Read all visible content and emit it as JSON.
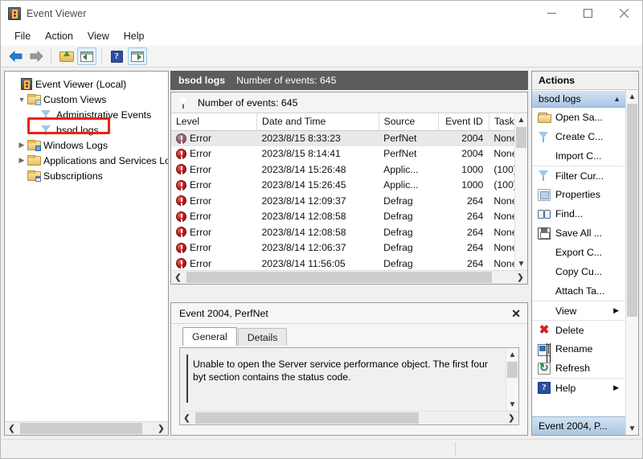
{
  "window": {
    "title": "Event Viewer",
    "icon": "event-viewer-icon",
    "controls": {
      "minimize": "minimize-icon",
      "maximize": "maximize-icon",
      "close": "close-icon"
    }
  },
  "menubar": {
    "items": [
      "File",
      "Action",
      "View",
      "Help"
    ]
  },
  "toolbar": {
    "buttons": [
      {
        "name": "back-icon",
        "label": "Back"
      },
      {
        "name": "forward-icon",
        "label": "Forward"
      },
      {
        "name": "up-folder-icon",
        "label": "Up One Level"
      },
      {
        "name": "show-hide-console-tree-icon",
        "label": "Show/Hide Console Tree"
      },
      {
        "name": "help-icon",
        "label": "Help"
      },
      {
        "name": "show-hide-action-pane-icon",
        "label": "Show/Hide Action Pane"
      }
    ]
  },
  "tree": {
    "nodes": [
      {
        "label": "Event Viewer (Local)",
        "icon": "event-viewer-icon",
        "indent": 0,
        "twist": "",
        "selected": false
      },
      {
        "label": "Custom Views",
        "icon": "folder-icon",
        "indent": 1,
        "twist": "expanded",
        "selected": false
      },
      {
        "label": "Administrative Events",
        "icon": "filter-icon",
        "indent": 2,
        "twist": "",
        "selected": false
      },
      {
        "label": "bsod logs",
        "icon": "filter-icon",
        "indent": 2,
        "twist": "",
        "selected": true
      },
      {
        "label": "Windows Logs",
        "icon": "folder-blue-icon",
        "indent": 1,
        "twist": "collapsed",
        "selected": false
      },
      {
        "label": "Applications and Services Lo",
        "icon": "folder-icon",
        "indent": 1,
        "twist": "collapsed",
        "selected": false
      },
      {
        "label": "Subscriptions",
        "icon": "folder-calendar-icon",
        "indent": 1,
        "twist": "",
        "selected": false
      }
    ],
    "highlight_color": "#ee2211"
  },
  "center": {
    "header": {
      "name": "bsod logs",
      "count_label": "Number of events: 645"
    },
    "filter_bar": {
      "icon": "filter-icon",
      "text": "Number of events: 645"
    },
    "columns": [
      {
        "label": "Level",
        "align": "left"
      },
      {
        "label": "Date and Time",
        "align": "left"
      },
      {
        "label": "Source",
        "align": "left"
      },
      {
        "label": "Event ID",
        "align": "right"
      },
      {
        "label": "Task Ca",
        "align": "left"
      }
    ],
    "rows": [
      {
        "level": "Error",
        "datetime": "2023/8/15 8:33:23",
        "source": "PerfNet",
        "event_id": "2004",
        "task": "None",
        "selected": true
      },
      {
        "level": "Error",
        "datetime": "2023/8/15 8:14:41",
        "source": "PerfNet",
        "event_id": "2004",
        "task": "None",
        "selected": false
      },
      {
        "level": "Error",
        "datetime": "2023/8/14 15:26:48",
        "source": "Applic...",
        "event_id": "1000",
        "task": "(100)",
        "selected": false
      },
      {
        "level": "Error",
        "datetime": "2023/8/14 15:26:45",
        "source": "Applic...",
        "event_id": "1000",
        "task": "(100)",
        "selected": false
      },
      {
        "level": "Error",
        "datetime": "2023/8/14 12:09:37",
        "source": "Defrag",
        "event_id": "264",
        "task": "None",
        "selected": false
      },
      {
        "level": "Error",
        "datetime": "2023/8/14 12:08:58",
        "source": "Defrag",
        "event_id": "264",
        "task": "None",
        "selected": false
      },
      {
        "level": "Error",
        "datetime": "2023/8/14 12:08:58",
        "source": "Defrag",
        "event_id": "264",
        "task": "None",
        "selected": false
      },
      {
        "level": "Error",
        "datetime": "2023/8/14 12:06:37",
        "source": "Defrag",
        "event_id": "264",
        "task": "None",
        "selected": false
      },
      {
        "level": "Error",
        "datetime": "2023/8/14 11:56:05",
        "source": "Defrag",
        "event_id": "264",
        "task": "None",
        "selected": false
      }
    ]
  },
  "detail": {
    "title": "Event 2004, PerfNet",
    "close_icon": "close-icon",
    "tabs": [
      {
        "label": "General",
        "active": true
      },
      {
        "label": "Details",
        "active": false
      }
    ],
    "description": "Unable to open the Server service performance object. The first four byt section contains the status code."
  },
  "actions": {
    "title": "Actions",
    "group": {
      "label": "bsod logs",
      "caret": "collapse-caret-icon"
    },
    "items": [
      {
        "label": "Open Sa...",
        "icon": "open-folder-icon",
        "submenu": false
      },
      {
        "label": "Create C...",
        "icon": "filter-icon",
        "submenu": false
      },
      {
        "label": "Import C...",
        "icon": "",
        "submenu": false
      },
      {
        "label": "Filter Cur...",
        "icon": "filter-icon",
        "submenu": false,
        "separator": true
      },
      {
        "label": "Properties",
        "icon": "properties-icon",
        "submenu": false
      },
      {
        "label": "Find...",
        "icon": "find-icon",
        "submenu": false
      },
      {
        "label": "Save All ...",
        "icon": "save-icon",
        "submenu": false
      },
      {
        "label": "Export C...",
        "icon": "",
        "submenu": false
      },
      {
        "label": "Copy Cu...",
        "icon": "",
        "submenu": false
      },
      {
        "label": "Attach Ta...",
        "icon": "",
        "submenu": false
      },
      {
        "label": "View",
        "icon": "",
        "submenu": true,
        "separator": true
      },
      {
        "label": "Delete",
        "icon": "delete-icon",
        "submenu": false,
        "separator": true
      },
      {
        "label": "Rename",
        "icon": "rename-icon",
        "submenu": false
      },
      {
        "label": "Refresh",
        "icon": "refresh-icon",
        "submenu": false
      },
      {
        "label": "Help",
        "icon": "help-icon",
        "submenu": true,
        "separator": true
      }
    ],
    "footer": {
      "label": "Event 2004, P...",
      "caret": "collapse-caret-icon"
    }
  },
  "statusbar": {
    "text": ""
  },
  "colors": {
    "list_header_bg": "#5c5c5c",
    "actions_group_bg": "#aac6e4",
    "error_red": "#b01414",
    "annotation_red": "#ee2211"
  }
}
